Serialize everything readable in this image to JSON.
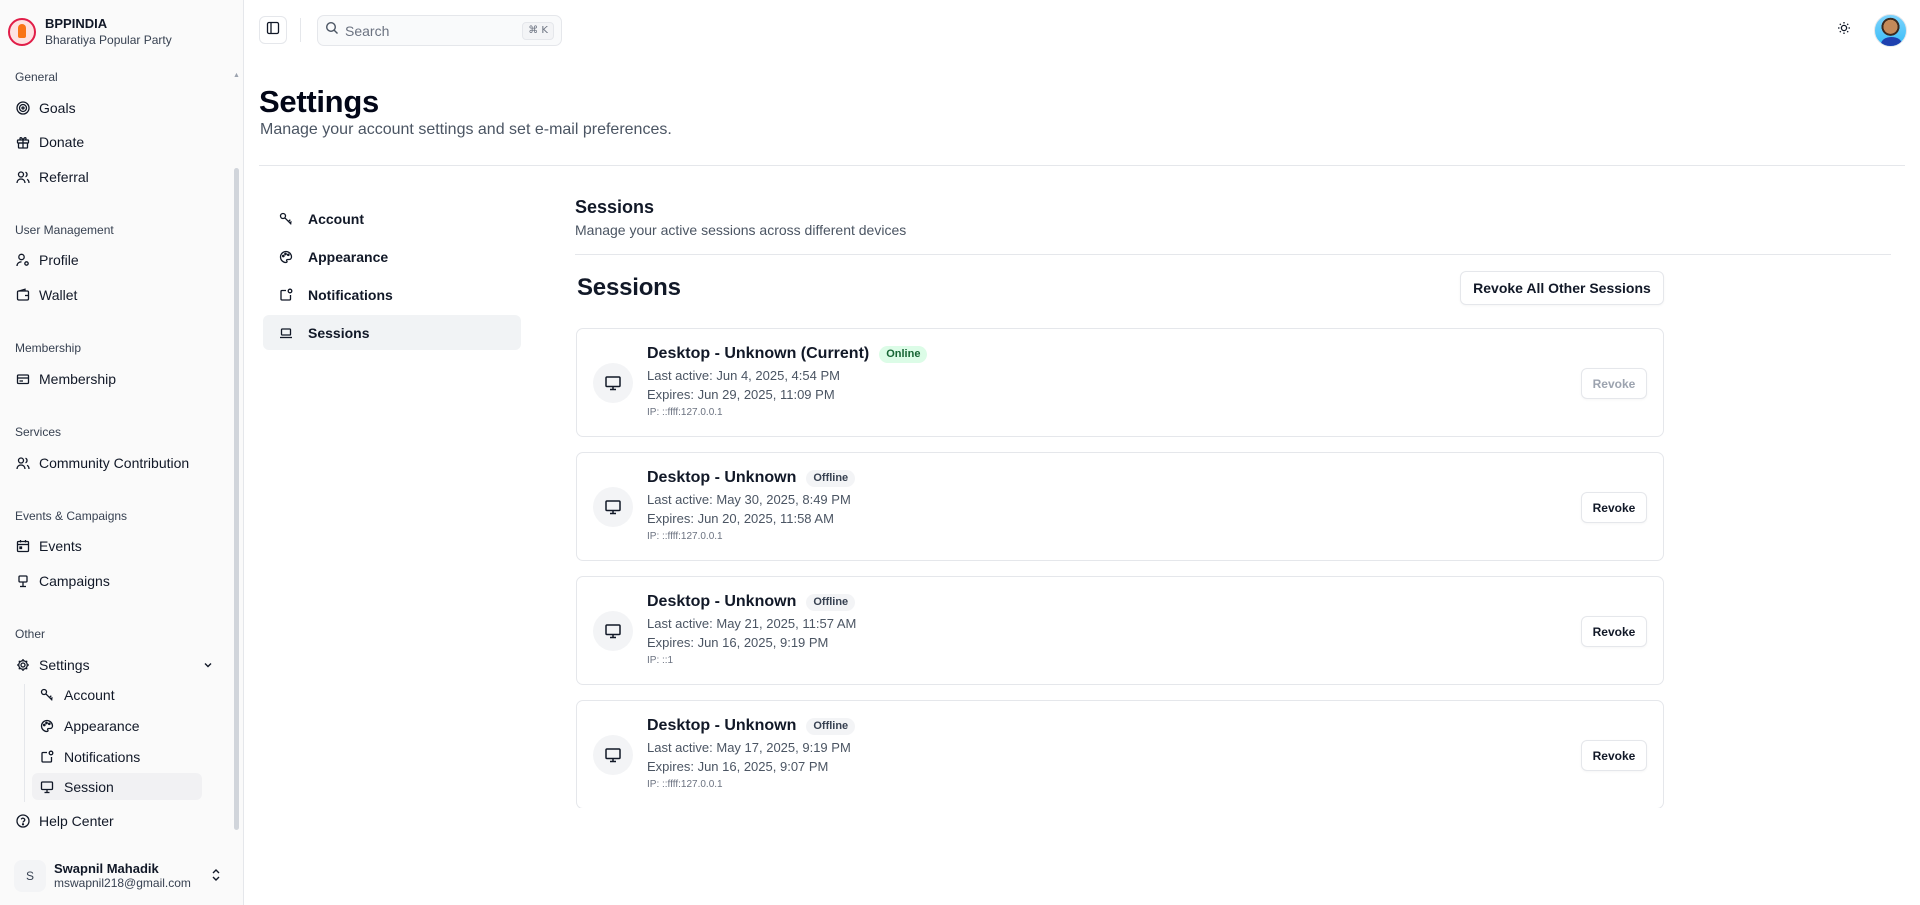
{
  "brand": {
    "name": "BPPINDIA",
    "subtitle": "Bharatiya Popular Party"
  },
  "sidebar": {
    "groups": {
      "general": "General",
      "user_management": "User Management",
      "membership": "Membership",
      "services": "Services",
      "events_campaigns": "Events & Campaigns",
      "other": "Other"
    },
    "items": {
      "goals": "Goals",
      "donate": "Donate",
      "referral": "Referral",
      "profile": "Profile",
      "wallet": "Wallet",
      "membership": "Membership",
      "community_contribution": "Community Contribution",
      "events": "Events",
      "campaigns": "Campaigns",
      "settings": "Settings",
      "help_center": "Help Center"
    },
    "settings_sub": {
      "account": "Account",
      "appearance": "Appearance",
      "notifications": "Notifications",
      "session": "Session"
    }
  },
  "user": {
    "initial": "S",
    "name": "Swapnil Mahadik",
    "email": "mswapnil218@gmail.com"
  },
  "topbar": {
    "search_placeholder": "Search",
    "shortcut": "⌘ K"
  },
  "page": {
    "title": "Settings",
    "subtitle": "Manage your account settings and set e-mail preferences."
  },
  "settings_nav": {
    "account": "Account",
    "appearance": "Appearance",
    "notifications": "Notifications",
    "sessions": "Sessions"
  },
  "sessions": {
    "section_title": "Sessions",
    "section_subtitle": "Manage your active sessions across different devices",
    "heading": "Sessions",
    "revoke_all_label": "Revoke All Other Sessions",
    "items": [
      {
        "device": "Desktop - Unknown (Current)",
        "status": "Online",
        "last_active": "Last active: Jun 4, 2025, 4:54 PM",
        "expires": "Expires: Jun 29, 2025, 11:09 PM",
        "ip": "IP: ::ffff:127.0.0.1",
        "revoke_label": "Revoke"
      },
      {
        "device": "Desktop - Unknown",
        "status": "Offline",
        "last_active": "Last active: May 30, 2025, 8:49 PM",
        "expires": "Expires: Jun 20, 2025, 11:58 AM",
        "ip": "IP: ::ffff:127.0.0.1",
        "revoke_label": "Revoke"
      },
      {
        "device": "Desktop - Unknown",
        "status": "Offline",
        "last_active": "Last active: May 21, 2025, 11:57 AM",
        "expires": "Expires: Jun 16, 2025, 9:19 PM",
        "ip": "IP: ::1",
        "revoke_label": "Revoke"
      },
      {
        "device": "Desktop - Unknown",
        "status": "Offline",
        "last_active": "Last active: May 17, 2025, 9:19 PM",
        "expires": "Expires: Jun 16, 2025, 9:07 PM",
        "ip": "IP: ::ffff:127.0.0.1",
        "revoke_label": "Revoke"
      }
    ]
  },
  "colors": {
    "online_bg": "#dcfce7",
    "online_text": "#166534",
    "active_nav": "#f1f3f5",
    "border": "#e5e7eb"
  }
}
